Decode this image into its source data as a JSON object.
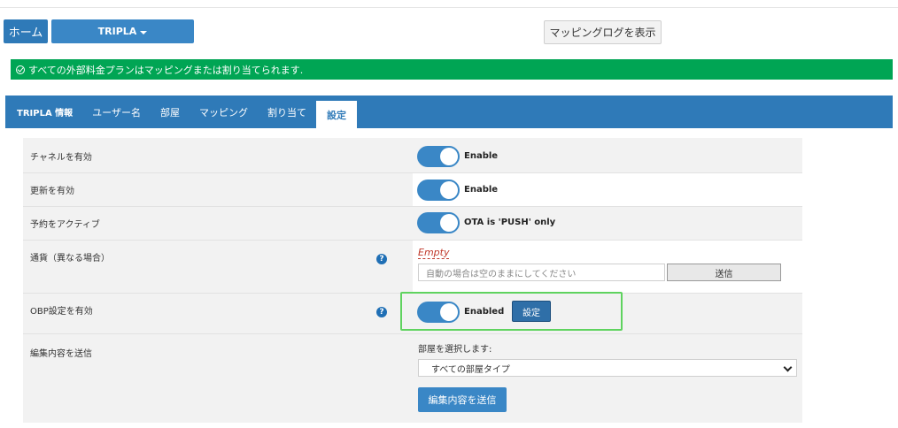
{
  "header": {
    "home_label": "ホーム",
    "property_label": "TRIPLA",
    "mapping_log_label": "マッピングログを表示"
  },
  "alert": {
    "message": "すべての外部料金プランはマッピングまたは割り当てられます."
  },
  "tabs": [
    {
      "label": "TRIPLA 情報",
      "active": false
    },
    {
      "label": "ユーザー名",
      "active": false
    },
    {
      "label": "部屋",
      "active": false
    },
    {
      "label": "マッピング",
      "active": false
    },
    {
      "label": "割り当て",
      "active": false
    },
    {
      "label": "設定",
      "active": true
    }
  ],
  "settings": {
    "channel_enable": {
      "label": "チャネルを有効",
      "state": "Enable",
      "on": true
    },
    "update_enable": {
      "label": "更新を有効",
      "state": "Enable",
      "on": true
    },
    "reservation_active": {
      "label": "予約をアクティブ",
      "state": "OTA is 'PUSH' only",
      "on": true
    },
    "currency": {
      "label": "通貨（異なる場合）",
      "help": "?",
      "value": "Empty",
      "placeholder": "自動の場合は空のままにしてください",
      "send_label": "送信"
    },
    "obp": {
      "label": "OBP設定を有効",
      "help": "?",
      "state": "Enabled",
      "on": true,
      "config_label": "設定"
    },
    "submit_edits": {
      "label": "編集内容を送信",
      "room_select_label": "部屋を選択します:",
      "room_selected": "すべての部屋タイプ",
      "submit_label": "編集内容を送信"
    }
  },
  "colors": {
    "primary": "#2f7ab8",
    "success": "#00a554",
    "highlight": "#5fd35f",
    "error_text": "#c0392b"
  }
}
